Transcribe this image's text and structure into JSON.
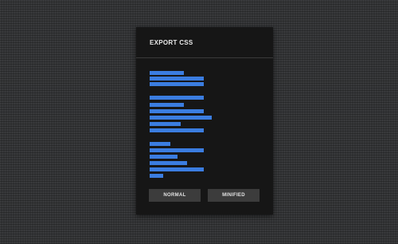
{
  "panel": {
    "title": "EXPORT CSS"
  },
  "buttons": {
    "normal_label": "NORMAL",
    "minified_label": "MINIFIED"
  },
  "colors": {
    "background": "#333436",
    "panel": "#161616",
    "code_bar": "#3b7de0",
    "button": "#3c3c3c"
  }
}
